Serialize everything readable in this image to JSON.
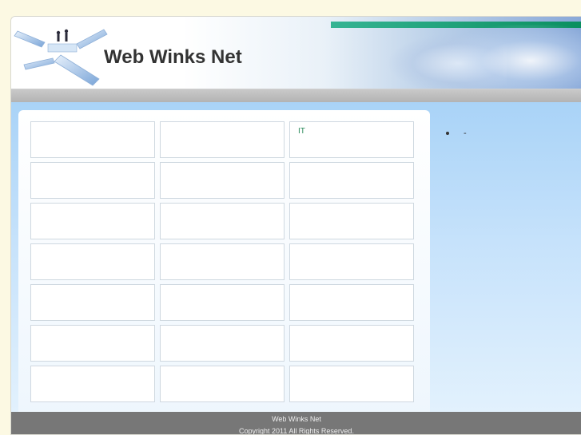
{
  "header": {
    "site_title": "Web Winks Net"
  },
  "grid": {
    "cells": [
      {
        "label": ""
      },
      {
        "label": ""
      },
      {
        "label": "IT"
      },
      {
        "label": ""
      },
      {
        "label": ""
      },
      {
        "label": ""
      },
      {
        "label": ""
      },
      {
        "label": ""
      },
      {
        "label": ""
      },
      {
        "label": ""
      },
      {
        "label": ""
      },
      {
        "label": ""
      },
      {
        "label": ""
      },
      {
        "label": ""
      },
      {
        "label": ""
      },
      {
        "label": ""
      },
      {
        "label": ""
      },
      {
        "label": ""
      },
      {
        "label": ""
      },
      {
        "label": ""
      },
      {
        "label": ""
      }
    ],
    "link_color": "#2a8a5a"
  },
  "sidebar": {
    "items": [
      {
        "label": "-"
      }
    ]
  },
  "footer": {
    "site_name": "Web Winks Net",
    "copyright": "Copyright 2011 All Rights Reserved."
  },
  "colors": {
    "page_bg": "#fcf9e3",
    "header_stripe": "#0a8f5f",
    "nav_bar": "#b3b3b3",
    "content_bg": "#a9d3f7",
    "footer_bg": "#777777"
  }
}
